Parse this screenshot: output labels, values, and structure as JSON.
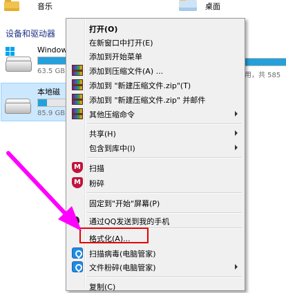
{
  "explorer": {
    "top_folders": [
      {
        "label": "音乐",
        "icon": "music-folder-icon"
      },
      {
        "label": "桌面",
        "icon": "desktop-folder-icon"
      }
    ],
    "section_header": "设备和驱动器",
    "drives": [
      {
        "name": "Windows",
        "size_text": "63.5 GB",
        "usage_fraction": 0.9,
        "selected": false
      },
      {
        "name": "本地磁盘",
        "size_text": "85.9 GB",
        "usage_fraction": 0.3,
        "selected": true
      }
    ],
    "right_drive_text": "用，共 585"
  },
  "context_menu": {
    "items": [
      {
        "label": "打开(O)",
        "bold": true,
        "icon": null
      },
      {
        "label": "在新窗口中打开(E)",
        "icon": null
      },
      {
        "label": "添加到开始菜单",
        "icon": null
      },
      {
        "label": "添加到压缩文件(A) ...",
        "icon": "winrar-icon"
      },
      {
        "label": "添加到 \"新建压缩文件.zip\"(T)",
        "icon": "winrar-icon"
      },
      {
        "label": "添加到 \"新建压缩文件.zip\" 并邮件",
        "icon": "winrar-icon"
      },
      {
        "label": "其他压缩命令",
        "icon": "winrar-icon",
        "submenu": true
      },
      {
        "label": "共享(H)",
        "icon": null,
        "submenu": true
      },
      {
        "label": "包含到库中(I)",
        "icon": null,
        "submenu": true
      },
      {
        "label": "扫描",
        "icon": "mcafee-icon"
      },
      {
        "label": "粉碎",
        "icon": "mcafee-icon"
      },
      {
        "label": "固定到\"开始\"屏幕(P)",
        "icon": null
      },
      {
        "label": "通过QQ发送到我的手机",
        "icon": "qq-icon"
      },
      {
        "label": "格式化(A)...",
        "icon": null,
        "highlighted": true
      },
      {
        "label": "扫描病毒(电脑管家)",
        "icon": "qq-pc-manager-icon"
      },
      {
        "label": "文件粉碎(电脑管家)",
        "icon": "qq-pc-manager-icon",
        "submenu": true
      },
      {
        "label": "复制(C)",
        "icon": null
      }
    ]
  },
  "colors": {
    "annotation_arrow": "#ff00ff",
    "highlight_border": "#e30000",
    "selection_bg": "#cce8ff"
  }
}
